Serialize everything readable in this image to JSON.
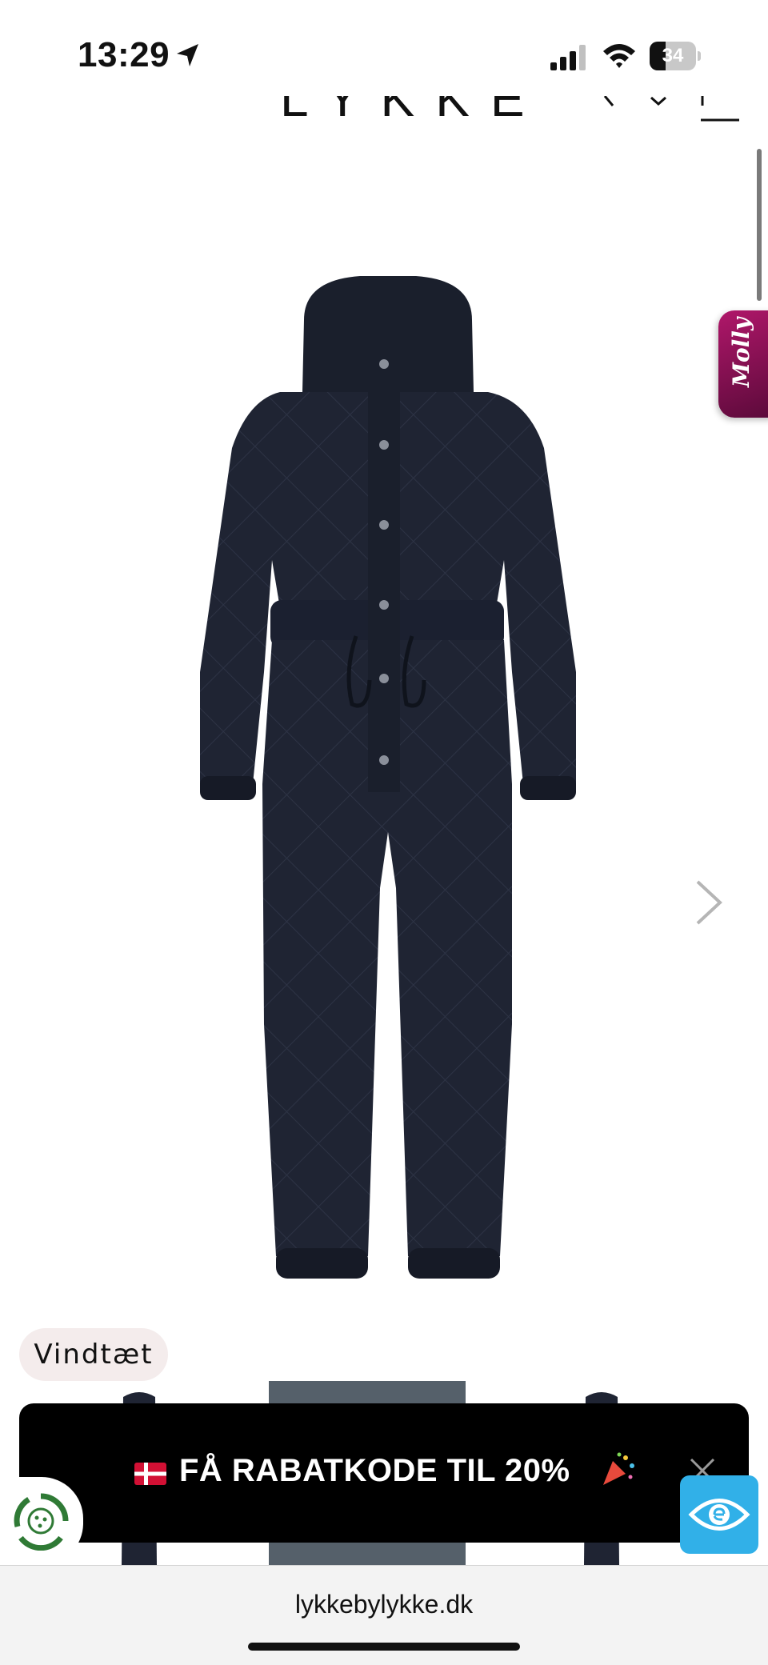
{
  "status_bar": {
    "time": "13:29",
    "battery_level": "34",
    "battery_fraction": 0.34
  },
  "header": {
    "logo": "LYKKE",
    "icons": [
      "search-icon",
      "account-icon",
      "menu-icon"
    ]
  },
  "gallery": {
    "badge": "Vindtæt",
    "next_icon": "chevron-right-icon",
    "product_color": "#1f2433"
  },
  "molly_tab": {
    "label": "Molly"
  },
  "promo": {
    "text": "FÅ RABATKODE TIL 20%",
    "flag_icon": "denmark-flag-icon",
    "party_icon": "party-popper-icon",
    "close_icon": "close-icon"
  },
  "floating": {
    "cookie_icon": "cookie-settings-icon",
    "accessibility_icon": "accessibility-eye-icon",
    "accessibility_color": "#31b0e8"
  },
  "browser": {
    "url": "lykkebylykke.dk"
  }
}
